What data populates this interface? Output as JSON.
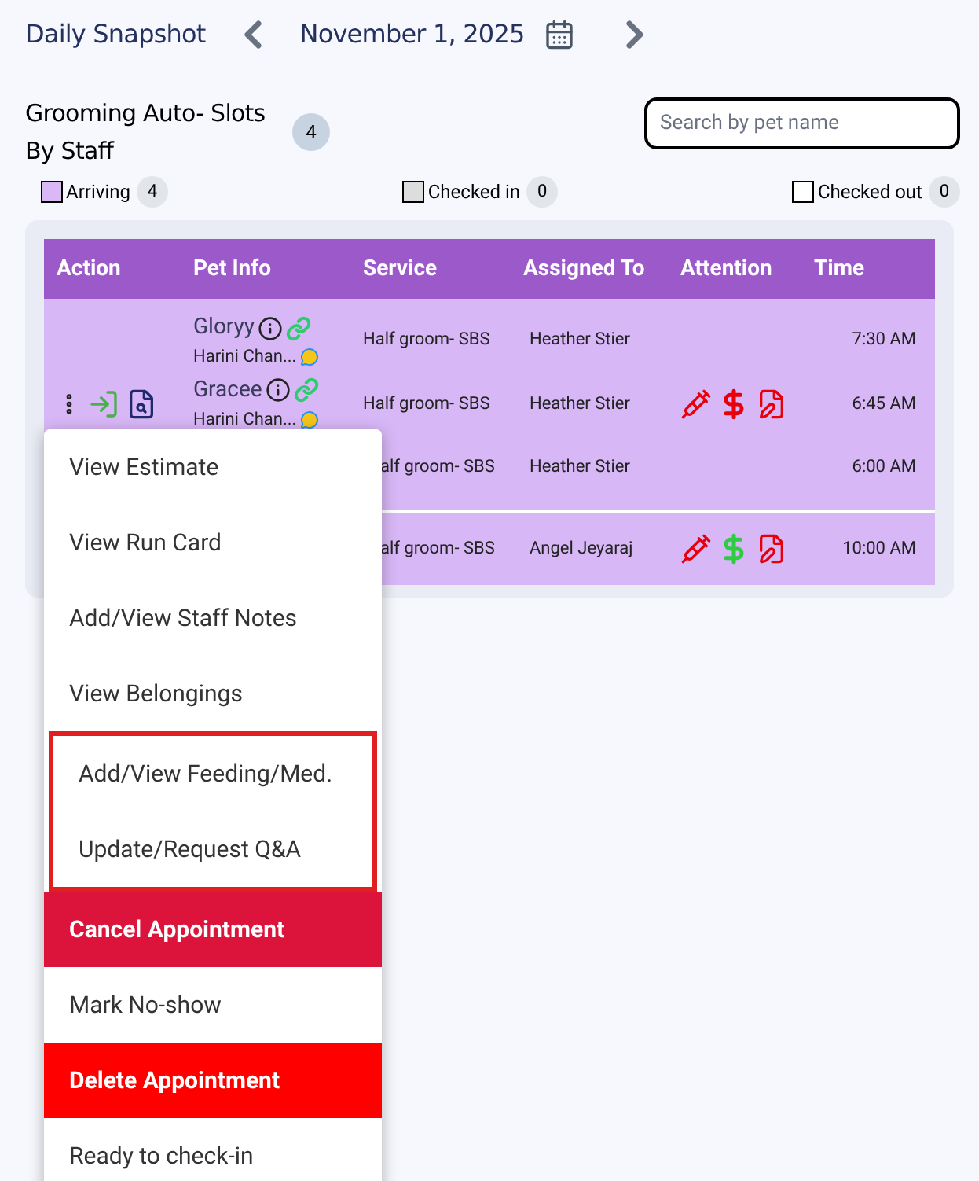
{
  "header": {
    "title": "Daily Snapshot",
    "date": "November 1, 2025"
  },
  "section": {
    "title": "Grooming Auto- Slots By Staff",
    "count": "4",
    "search": {
      "placeholder": "Search by pet name"
    }
  },
  "legend": [
    {
      "label": "Arriving",
      "count": "4",
      "color": "#d9b8f5"
    },
    {
      "label": "Checked in",
      "count": "0",
      "color": "#dddddd"
    },
    {
      "label": "Checked out",
      "count": "0",
      "color": "#ffffff"
    }
  ],
  "table": {
    "columns": [
      "Action",
      "Pet Info",
      "Service",
      "Assigned To",
      "Attention",
      "Time"
    ],
    "rows": [
      {
        "pets": [
          {
            "name": "Gloryy",
            "owner": "Harini Chan..."
          },
          {
            "name": "Gracee",
            "owner": "Harini Chan..."
          }
        ],
        "services": [
          "Half groom- SBS",
          "Half groom- SBS",
          "alf groom- SBS"
        ],
        "staff": [
          "Heather Stier",
          "Heather Stier",
          "Heather Stier"
        ],
        "paid": false,
        "times": [
          "7:30 AM",
          "6:45 AM",
          "6:00 AM"
        ]
      },
      {
        "pets": [],
        "services": [
          "alf groom- SBS"
        ],
        "staff": [
          "Angel Jeyaraj"
        ],
        "paid": true,
        "times": [
          "10:00 AM"
        ]
      }
    ]
  },
  "menu": [
    {
      "label": "View Estimate",
      "kind": "normal",
      "highlighted": false
    },
    {
      "label": "View Run Card",
      "kind": "normal",
      "highlighted": false
    },
    {
      "label": "Add/View Staff Notes",
      "kind": "normal",
      "highlighted": false
    },
    {
      "label": "View Belongings",
      "kind": "normal",
      "highlighted": false
    },
    {
      "label": "Add/View Feeding/Med.",
      "kind": "normal",
      "highlighted": true
    },
    {
      "label": "Update/Request Q&A",
      "kind": "normal",
      "highlighted": true
    },
    {
      "label": "Cancel Appointment",
      "kind": "cancel",
      "highlighted": false
    },
    {
      "label": "Mark No-show",
      "kind": "normal",
      "highlighted": false
    },
    {
      "label": "Delete Appointment",
      "kind": "delete",
      "highlighted": false
    },
    {
      "label": "Ready to check-in",
      "kind": "normal",
      "highlighted": false
    }
  ]
}
